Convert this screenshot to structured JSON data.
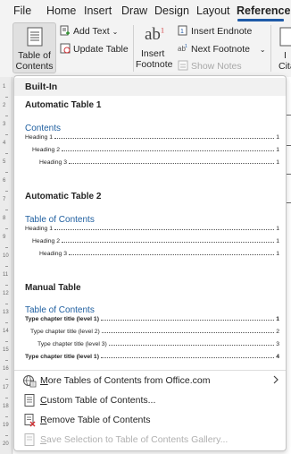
{
  "tabs": [
    {
      "label": "File"
    },
    {
      "label": "Home"
    },
    {
      "label": "Insert"
    },
    {
      "label": "Draw"
    },
    {
      "label": "Design"
    },
    {
      "label": "Layout"
    },
    {
      "label": "References"
    }
  ],
  "ribbon": {
    "toc_line1": "Table of",
    "toc_line2": "Contents",
    "add_text": "Add Text",
    "update_table": "Update Table",
    "insert_footnote_line1": "Insert",
    "insert_footnote_line2": "Footnote",
    "insert_endnote": "Insert Endnote",
    "next_footnote": "Next Footnote",
    "show_notes": "Show Notes",
    "citation_line1": "I",
    "citation_line2": "Cita",
    "ab_mark": "ab",
    "ab_sup": "1"
  },
  "panel": {
    "builtin_label": "Built-In",
    "auto1": {
      "title": "Automatic Table 1",
      "heading": "Contents",
      "entries": [
        {
          "text": "Heading 1",
          "page": "1"
        },
        {
          "text": "Heading 2",
          "page": "1"
        },
        {
          "text": "Heading 3",
          "page": "1"
        }
      ]
    },
    "auto2": {
      "title": "Automatic Table 2",
      "heading": "Table of Contents",
      "entries": [
        {
          "text": "Heading 1",
          "page": "1"
        },
        {
          "text": "Heading 2",
          "page": "1"
        },
        {
          "text": "Heading 3",
          "page": "1"
        }
      ]
    },
    "manual": {
      "title": "Manual Table",
      "heading": "Table of Contents",
      "entries": [
        {
          "text": "Type chapter title (level 1)",
          "page": "1"
        },
        {
          "text": "Type chapter title (level 2)",
          "page": "2"
        },
        {
          "text": "Type chapter title (level 3)",
          "page": "3"
        },
        {
          "text": "Type chapter title (level 1)",
          "page": "4"
        }
      ]
    },
    "menu": {
      "more_pre": "",
      "more_acc": "M",
      "more_post": "ore Tables of Contents from Office.com",
      "custom_acc": "C",
      "custom_post": "ustom Table of Contents...",
      "remove_acc": "R",
      "remove_post": "emove Table of Contents",
      "save_acc": "S",
      "save_post": "ave Selection to Table of Contents Gallery..."
    }
  },
  "ruler": {
    "marks": [
      "1",
      "2",
      "3",
      "4",
      "5",
      "6",
      "7",
      "8",
      "9",
      "10",
      "11",
      "12",
      "13",
      "14",
      "15",
      "16",
      "17",
      "18",
      "19",
      "20"
    ]
  },
  "colors": {
    "accent": "#1e5aa8",
    "heading_blue": "#1f5fa0"
  }
}
